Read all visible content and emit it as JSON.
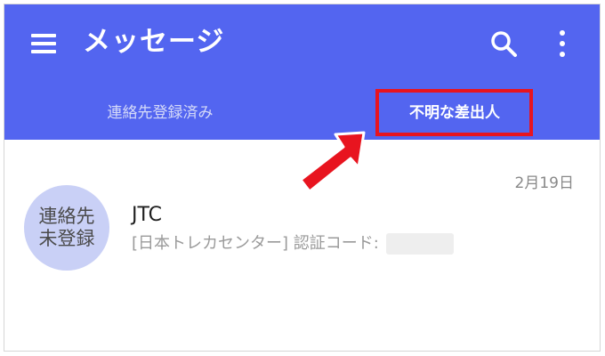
{
  "header": {
    "title": "メッセージ",
    "icons": [
      "menu-icon",
      "search-icon",
      "more-vert-icon"
    ]
  },
  "tabs": [
    {
      "label": "連絡先登録済み",
      "selected": false
    },
    {
      "label": "不明な差出人",
      "selected": true
    }
  ],
  "conversation": {
    "avatar_line1": "連絡先",
    "avatar_line2": "未登録",
    "sender": "JTC",
    "preview": "[日本トレカセンター] 認証コード:",
    "date": "2月19日"
  },
  "colors": {
    "appbar": "#5365f0",
    "highlight": "#e8141f",
    "avatar": "#c9d0f6"
  }
}
